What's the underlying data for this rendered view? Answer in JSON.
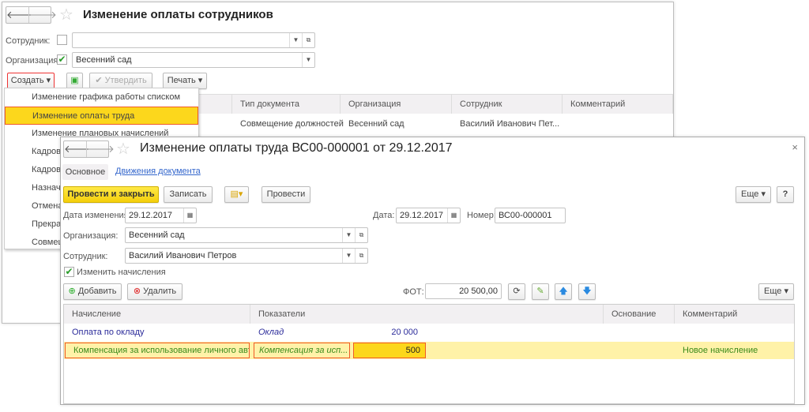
{
  "back": {
    "title": "Изменение оплаты сотрудников",
    "employee_label": "Сотрудник:",
    "employee_value": "",
    "org_label": "Организация:",
    "org_value": "Весенний сад",
    "create_btn": "Создать",
    "approve_btn": "Утвердить",
    "print_btn": "Печать",
    "columns": [
      "Тип документа",
      "Организация",
      "Сотрудник",
      "Комментарий"
    ],
    "rows": [
      [
        "Совмещение должностей",
        "Весенний сад",
        "Василий Иванович Пет...",
        ""
      ]
    ],
    "menu": [
      "Изменение графика работы списком",
      "Изменение оплаты труда",
      "Изменение плановых начислений",
      "Кадров",
      "Кадров",
      "Назнач",
      "Отмена",
      "Прекра",
      "Совмец"
    ]
  },
  "doc": {
    "title": "Изменение оплаты труда ВС00-000001 от 29.12.2017",
    "tabs": [
      "Основное",
      "Движения документа"
    ],
    "post_close": "Провести и закрыть",
    "save": "Записать",
    "post": "Провести",
    "more": "Еще",
    "help": "?",
    "close": "×",
    "date_change_label": "Дата изменения:",
    "date_change": "29.12.2017",
    "date_label": "Дата:",
    "date": "29.12.2017",
    "number_label": "Номер:",
    "number": "ВС00-000001",
    "org_label": "Организация:",
    "org": "Весенний сад",
    "emp_label": "Сотрудник:",
    "emp": "Василий Иванович Петров",
    "change_accruals": "Изменить начисления",
    "add": "Добавить",
    "delete": "Удалить",
    "fot_label": "ФОТ:",
    "fot": "20 500,00",
    "more2": "Еще",
    "columns": [
      "Начисление",
      "Показатели",
      "Основание",
      "Комментарий"
    ],
    "rows": [
      {
        "accrual": "Оплата по окладу",
        "indicator": "Оклад",
        "value": "20 000",
        "basis": "",
        "comment": ""
      },
      {
        "accrual": "Компенсация за использование личного авт...",
        "indicator": "Компенсация за исп...",
        "value": "500",
        "basis": "",
        "comment": "Новое начисление"
      }
    ]
  }
}
